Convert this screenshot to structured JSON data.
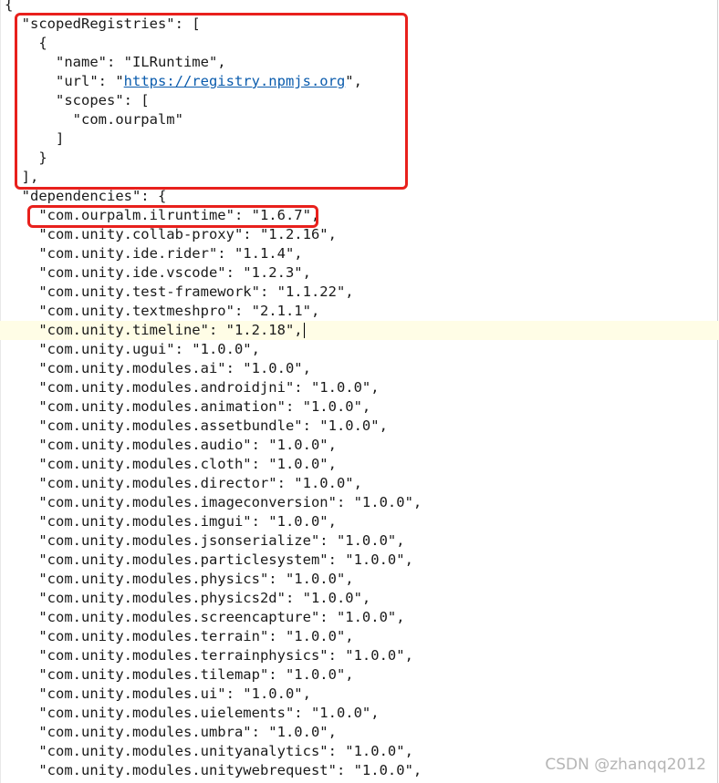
{
  "lines": [
    "{",
    "  \"scopedRegistries\": [",
    "    {",
    "      \"name\": \"ILRuntime\",",
    "      \"url\": \"https://registry.npmjs.org\",",
    "      \"scopes\": [",
    "        \"com.ourpalm\"",
    "      ]",
    "    }",
    "  ],",
    "  \"dependencies\": {",
    "    \"com.ourpalm.ilruntime\": \"1.6.7\",",
    "    \"com.unity.collab-proxy\": \"1.2.16\",",
    "    \"com.unity.ide.rider\": \"1.1.4\",",
    "    \"com.unity.ide.vscode\": \"1.2.3\",",
    "    \"com.unity.test-framework\": \"1.1.22\",",
    "    \"com.unity.textmeshpro\": \"2.1.1\",",
    "    \"com.unity.timeline\": \"1.2.18\",",
    "    \"com.unity.ugui\": \"1.0.0\",",
    "    \"com.unity.modules.ai\": \"1.0.0\",",
    "    \"com.unity.modules.androidjni\": \"1.0.0\",",
    "    \"com.unity.modules.animation\": \"1.0.0\",",
    "    \"com.unity.modules.assetbundle\": \"1.0.0\",",
    "    \"com.unity.modules.audio\": \"1.0.0\",",
    "    \"com.unity.modules.cloth\": \"1.0.0\",",
    "    \"com.unity.modules.director\": \"1.0.0\",",
    "    \"com.unity.modules.imageconversion\": \"1.0.0\",",
    "    \"com.unity.modules.imgui\": \"1.0.0\",",
    "    \"com.unity.modules.jsonserialize\": \"1.0.0\",",
    "    \"com.unity.modules.particlesystem\": \"1.0.0\",",
    "    \"com.unity.modules.physics\": \"1.0.0\",",
    "    \"com.unity.modules.physics2d\": \"1.0.0\",",
    "    \"com.unity.modules.screencapture\": \"1.0.0\",",
    "    \"com.unity.modules.terrain\": \"1.0.0\",",
    "    \"com.unity.modules.terrainphysics\": \"1.0.0\",",
    "    \"com.unity.modules.tilemap\": \"1.0.0\",",
    "    \"com.unity.modules.ui\": \"1.0.0\",",
    "    \"com.unity.modules.uielements\": \"1.0.0\",",
    "    \"com.unity.modules.umbra\": \"1.0.0\",",
    "    \"com.unity.modules.unityanalytics\": \"1.0.0\",",
    "    \"com.unity.modules.unitywebrequest\": \"1.0.0\","
  ],
  "url_line": {
    "prefix": "      \"url\": \"",
    "link": "https://registry.npmjs.org",
    "suffix": "\","
  },
  "current_line_index": 17,
  "watermark": "CSDN @zhanqq2012",
  "colors": {
    "highlight_box": "#e8201c",
    "current_line_bg": "#fffde6",
    "link": "#0b5cad"
  }
}
